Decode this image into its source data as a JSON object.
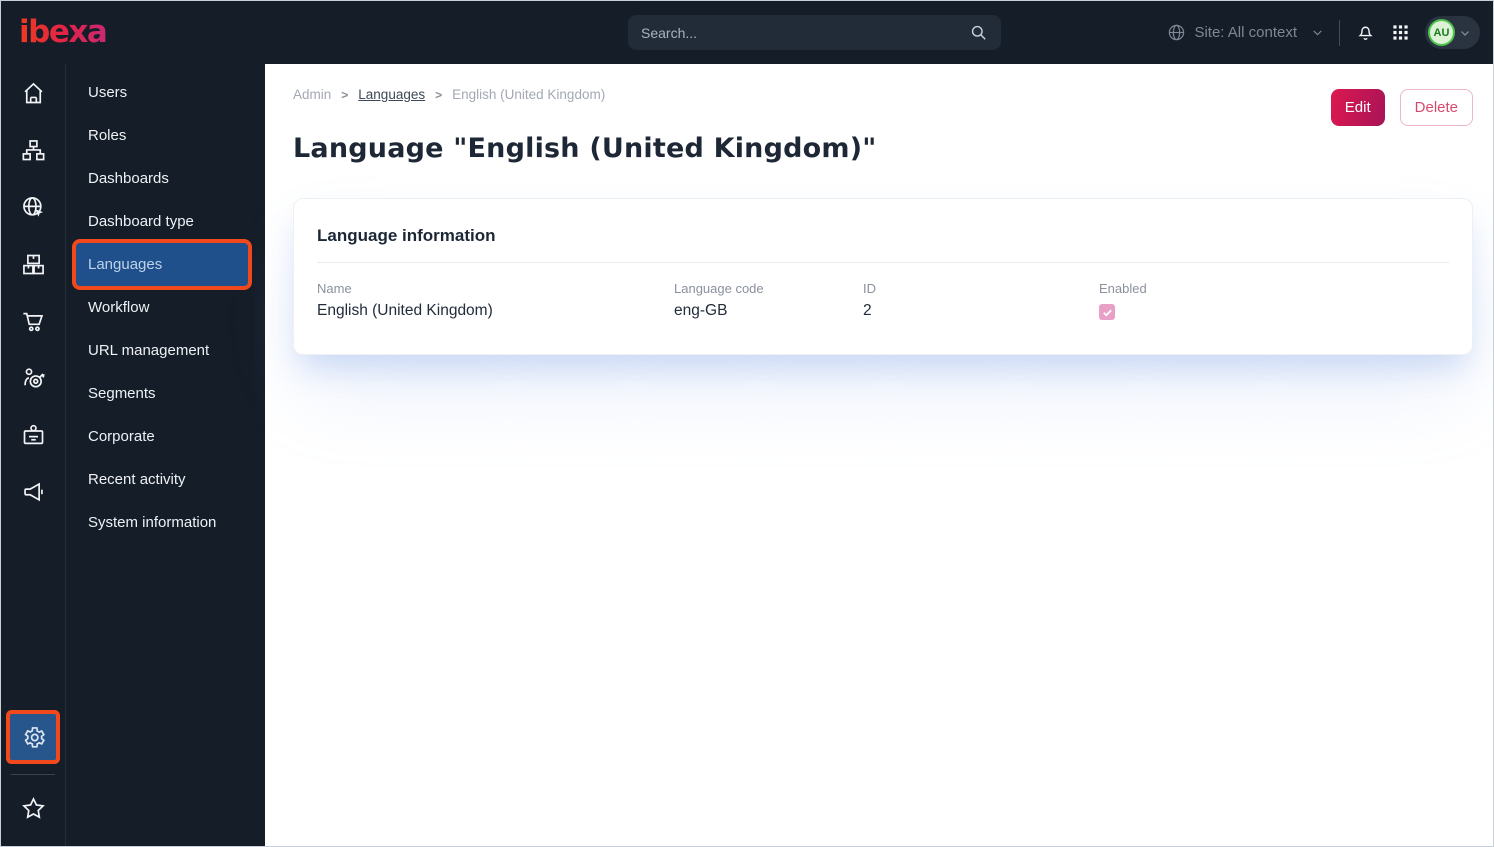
{
  "topbar": {
    "logo_text": "ibexa",
    "search_placeholder": "Search...",
    "site_context_label": "Site: All context",
    "avatar_initials": "AU"
  },
  "sidebar": {
    "items": [
      {
        "label": "Users",
        "active": false
      },
      {
        "label": "Roles",
        "active": false
      },
      {
        "label": "Dashboards",
        "active": false
      },
      {
        "label": "Dashboard type",
        "active": false
      },
      {
        "label": "Languages",
        "active": true
      },
      {
        "label": "Workflow",
        "active": false
      },
      {
        "label": "URL management",
        "active": false
      },
      {
        "label": "Segments",
        "active": false
      },
      {
        "label": "Corporate",
        "active": false
      },
      {
        "label": "Recent activity",
        "active": false
      },
      {
        "label": "System information",
        "active": false
      }
    ]
  },
  "breadcrumb": {
    "items": [
      "Admin",
      "Languages",
      "English (United Kingdom)"
    ],
    "separator": ">"
  },
  "actions": {
    "edit_label": "Edit",
    "delete_label": "Delete"
  },
  "page": {
    "title": "Language \"English (United Kingdom)\""
  },
  "card": {
    "title": "Language information",
    "fields": [
      {
        "label": "Name",
        "value": "English (United Kingdom)"
      },
      {
        "label": "Language code",
        "value": "eng-GB"
      },
      {
        "label": "ID",
        "value": "2"
      },
      {
        "label": "Enabled",
        "checked": true
      }
    ]
  },
  "colors": {
    "topbar_bg": "#151d28",
    "brand_gradient_start": "#ef3a21",
    "brand_gradient_end": "#c92a72",
    "primary_button": "#c8135a",
    "highlight_outline": "#f1481c",
    "active_item_bg": "#20508c",
    "avatar_green": "#4cc14c",
    "checkbox_pink": "#e9a0c6"
  }
}
